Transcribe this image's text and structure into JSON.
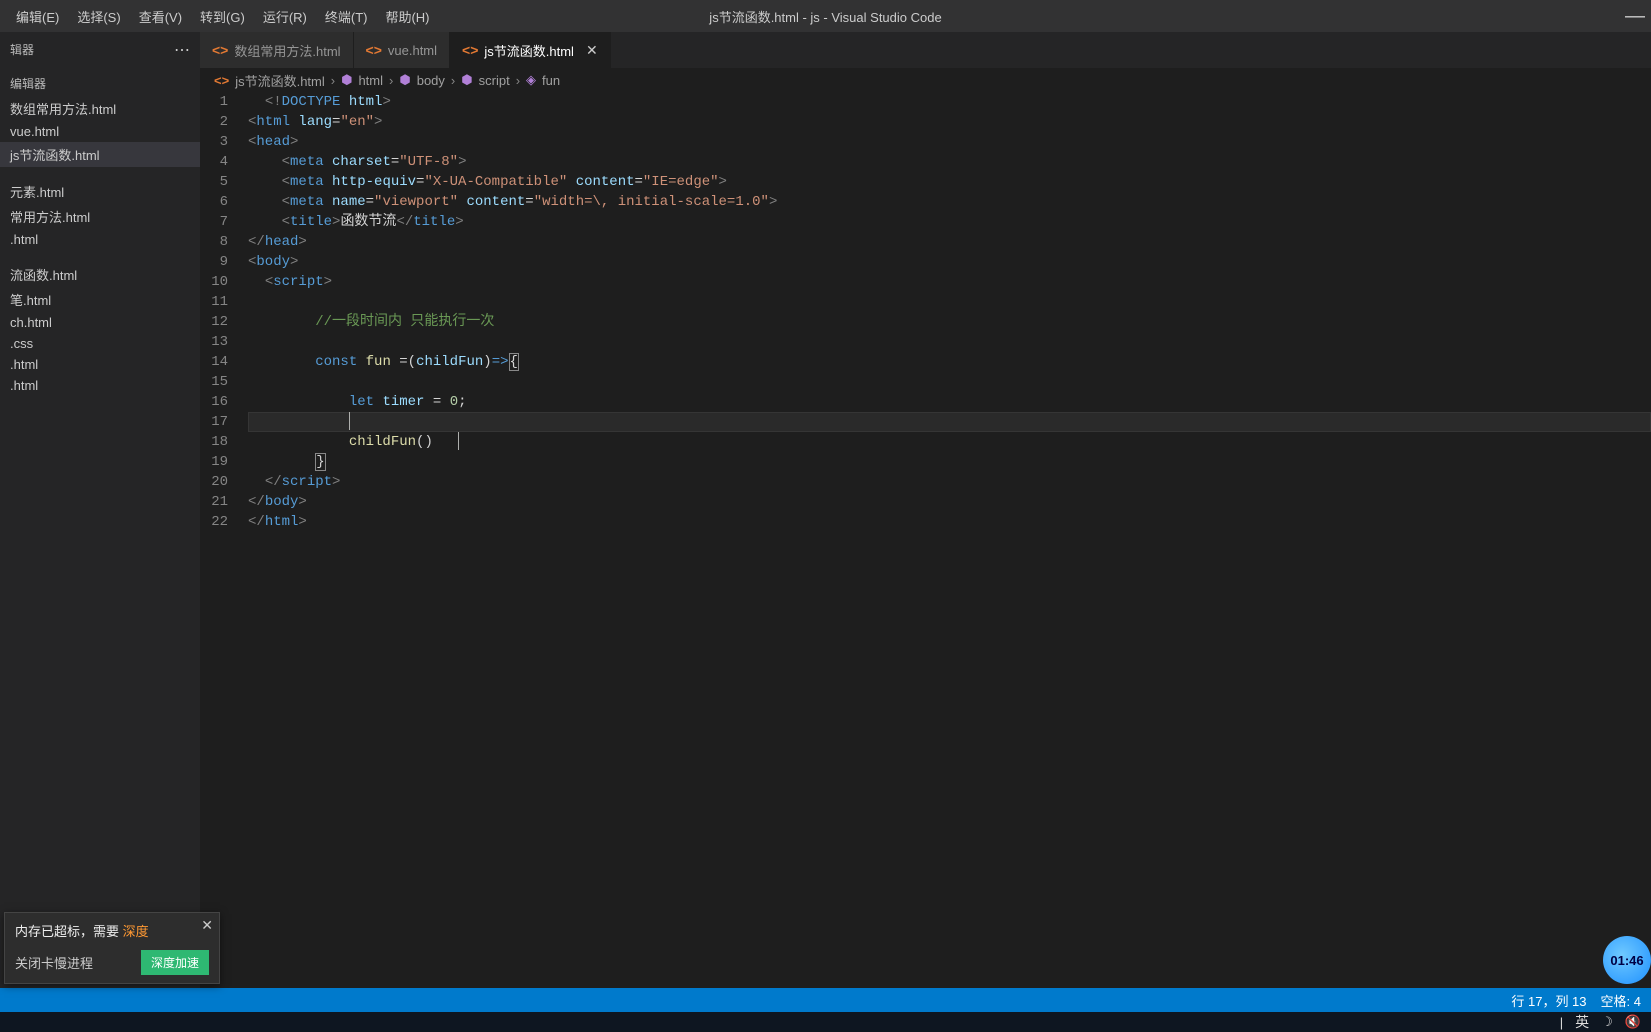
{
  "title": "js节流函数.html - js - Visual Studio Code",
  "menubar": [
    "编辑(E)",
    "选择(S)",
    "查看(V)",
    "转到(G)",
    "运行(R)",
    "终端(T)",
    "帮助(H)"
  ],
  "sidebar": {
    "header": "辑器",
    "section": "编辑器",
    "open_files": [
      "数组常用方法.html",
      "vue.html",
      "js节流函数.html"
    ],
    "active_index": 2,
    "files": [
      "元素.html",
      "常用方法.html",
      ".html",
      ".css",
      ".html",
      ".html"
    ],
    "section2": "流函数.html",
    "more_files": [
      "笔.html",
      "ch.html"
    ]
  },
  "tabs": [
    {
      "label": "数组常用方法.html",
      "active": false
    },
    {
      "label": "vue.html",
      "active": false
    },
    {
      "label": "js节流函数.html",
      "active": true
    }
  ],
  "breadcrumb": {
    "file": "js节流函数.html",
    "path": [
      "html",
      "body",
      "script",
      "fun"
    ]
  },
  "code": {
    "lines": 22,
    "current_line": 17,
    "title_text": "函数节流",
    "comment": "//一段时间内 只能执行一次",
    "fun_name": "fun",
    "param": "childFun",
    "timer_var": "timer",
    "timer_init": "0",
    "call": "childFun"
  },
  "statusbar": {
    "position": "行 17，列 13",
    "spaces": "空格: 4"
  },
  "notification": {
    "text": "内存已超标，需要 ",
    "highlight": "深度",
    "sub": "关闭卡慢进程",
    "button": "深度加速"
  },
  "taskbar": {
    "ime": "英",
    "time": "01:46"
  },
  "assistant": {
    "label": "01:46"
  }
}
